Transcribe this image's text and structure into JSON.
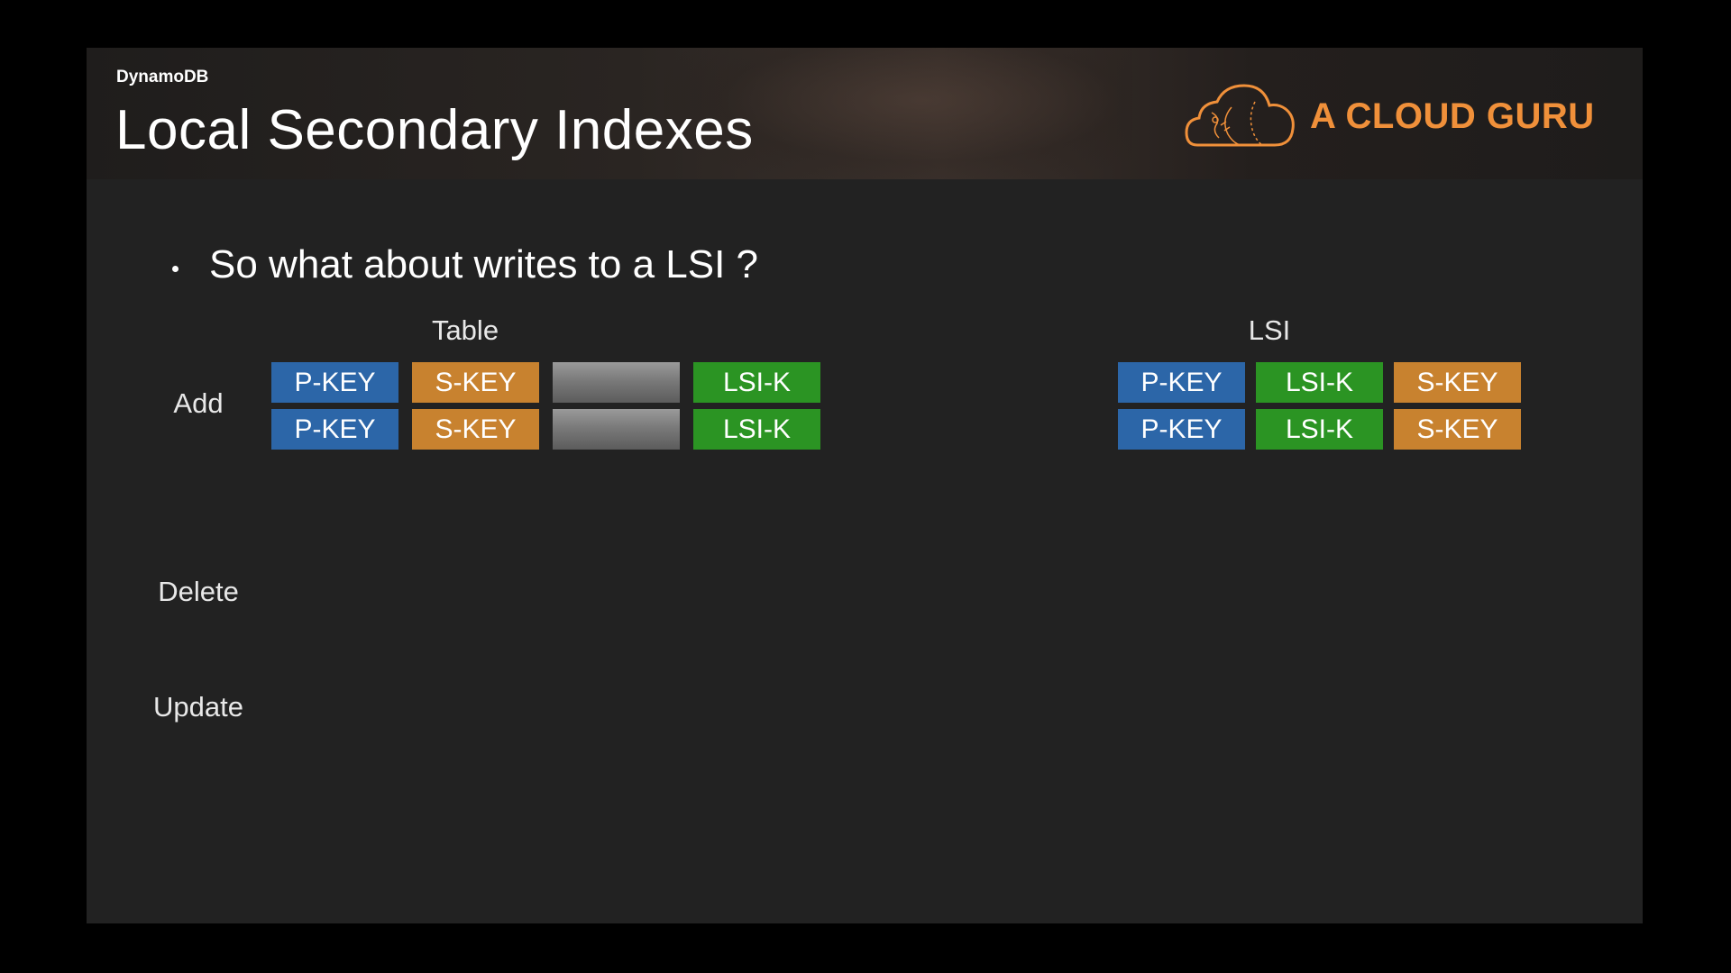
{
  "header": {
    "section": "DynamoDB",
    "title": "Local Secondary Indexes",
    "brand": "A CLOUD GURU"
  },
  "bullet": {
    "text": "So what about writes to a LSI ?"
  },
  "table_heading": "Table",
  "lsi_heading": "LSI",
  "row_labels": {
    "add": "Add",
    "delete": "Delete",
    "update": "Update"
  },
  "table_rows": [
    [
      "P-KEY",
      "S-KEY",
      "",
      "LSI-K"
    ],
    [
      "P-KEY",
      "S-KEY",
      "",
      "LSI-K"
    ]
  ],
  "lsi_rows": [
    [
      "P-KEY",
      "LSI-K",
      "S-KEY"
    ],
    [
      "P-KEY",
      "LSI-K",
      "S-KEY"
    ]
  ],
  "colors": {
    "p_key": "#2c66a8",
    "s_key": "#c8822f",
    "lsi_k": "#2b9423",
    "attribute": "#7a7a7a",
    "brand": "#f0903a"
  }
}
